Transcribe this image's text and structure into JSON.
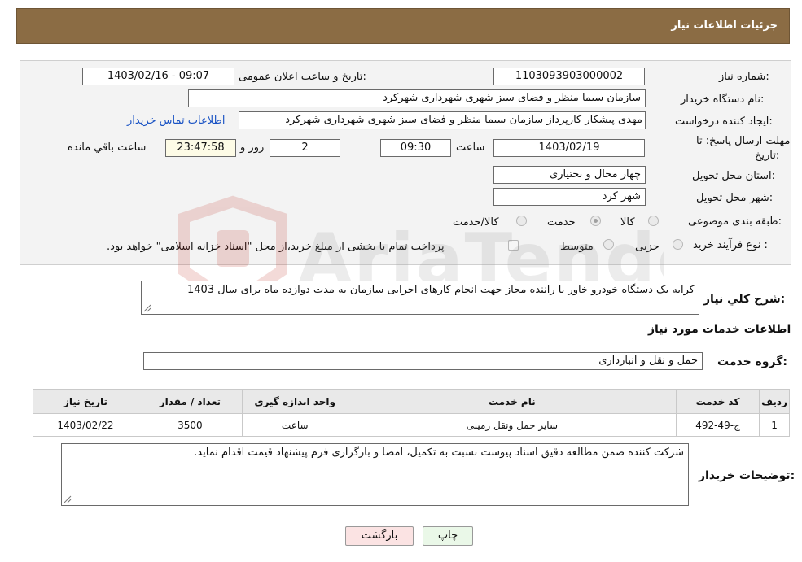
{
  "header": {
    "title": "جزئیات اطلاعات نیاز"
  },
  "form": {
    "need_number_label": "شماره نیاز:",
    "need_number": "1103093903000002",
    "announce_label": "تاریخ و ساعت اعلان عمومی:",
    "announce_value": "1403/02/16 - 09:07",
    "buyer_label": "نام دستگاه خریدار:",
    "buyer_value": "سازمان سیما منظر و فضای سبز شهری شهرداری شهرکرد",
    "creator_label": "ایجاد کننده درخواست:",
    "creator_value": "مهدی پیشکار کارپرداز سازمان سیما منظر و فضای سبز شهری شهرداری شهرکرد",
    "contact_link": "اطلاعات تماس خریدار",
    "deadline_label_1": "مهلت ارسال پاسخ: تا",
    "deadline_label_2": "تاریخ:",
    "deadline_date": "1403/02/19",
    "time_label": "ساعت",
    "deadline_time": "09:30",
    "days_value": "2",
    "days_label": "روز و",
    "remaining_time": "23:47:58",
    "remaining_label": "ساعت باقي مانده",
    "province_label": "استان محل تحویل:",
    "province_value": "چهار محال و بختیاری",
    "city_label": "شهر محل تحویل:",
    "city_value": "شهر کرد",
    "category_label": "طبقه بندی موضوعی:",
    "category_options": [
      "کالا",
      "خدمت",
      "کالا/خدمت"
    ],
    "purchase_label": "نوع فرآیند خرید :",
    "purchase_options": [
      "جزیی",
      "متوسط"
    ],
    "payment_note": "پرداخت تمام یا بخشی از مبلغ خرید،از محل \"اسناد خزانه اسلامی\" خواهد بود."
  },
  "summary": {
    "label": "شرح کلي نياز:",
    "text": "کرایه یک دستگاه خودرو خاور با راننده مجاز جهت انجام کارهای اجرایی سازمان به مدت دوازده ماه برای سال 1403"
  },
  "services": {
    "section_title": "اطلاعات خدمات مورد نیاز",
    "group_label": "گروه خدمت:",
    "group_value": "حمل و نقل و انبارداری",
    "table": {
      "headers": [
        "ردیف",
        "کد خدمت",
        "نام خدمت",
        "واحد اندازه گیری",
        "تعداد / مقدار",
        "تاریخ نیاز"
      ],
      "rows": [
        [
          "1",
          "ج-49-492",
          "سایر حمل ونقل زمینی",
          "ساعت",
          "3500",
          "1403/02/22"
        ]
      ]
    }
  },
  "notes": {
    "label": "توضیحات خریدار:",
    "text": "شرکت کننده ضمن مطالعه دقیق اسناد پیوست نسبت به تکمیل، امضا و بارگزاری فرم پیشنهاد قیمت اقدام نماید."
  },
  "buttons": {
    "print": "چاپ",
    "back": "بازگشت"
  },
  "colors": {
    "header_bg": "#8b6c44",
    "link": "#1a53c4",
    "back_btn_bg": "#fbe3e3",
    "print_btn_bg": "#eaf8e8"
  }
}
